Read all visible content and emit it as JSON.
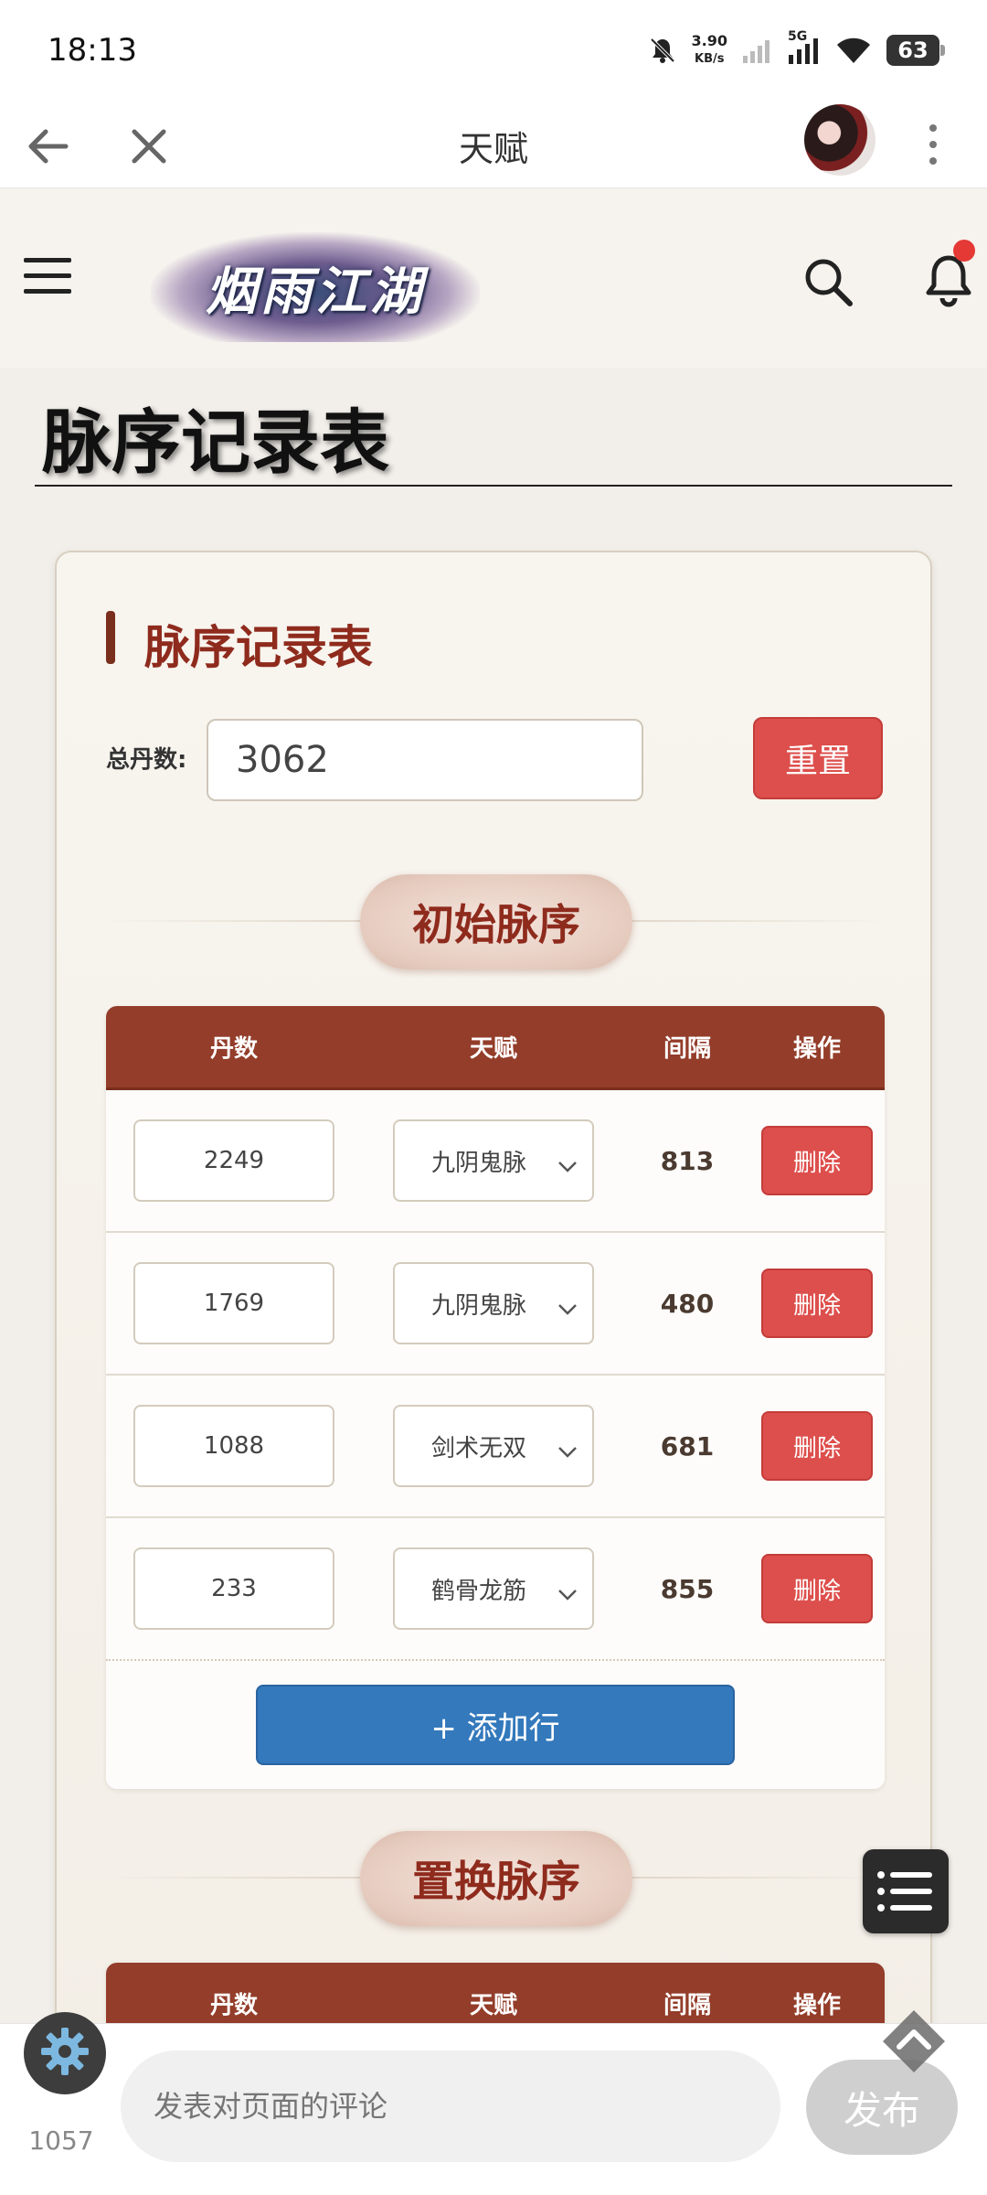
{
  "status_bar": {
    "time": "18:13",
    "net_speed_value": "3.90",
    "net_speed_unit": "KB/s",
    "network_type": "5G",
    "battery": "63"
  },
  "nav": {
    "title": "天赋"
  },
  "site_header": {
    "logo_text": "烟雨江湖"
  },
  "page": {
    "title": "脉序记录表"
  },
  "card": {
    "heading": "脉序记录表",
    "total_label": "总丹数:",
    "total_value": "3062",
    "reset_label": "重置"
  },
  "initial_section": {
    "badge": "初始脉序",
    "headers": [
      "丹数",
      "天赋",
      "间隔",
      "操作"
    ],
    "rows": [
      {
        "dan": "2249",
        "talent": "九阴鬼脉",
        "gap": "813",
        "action": "删除"
      },
      {
        "dan": "1769",
        "talent": "九阴鬼脉",
        "gap": "480",
        "action": "删除"
      },
      {
        "dan": "1088",
        "talent": "剑术无双",
        "gap": "681",
        "action": "删除"
      },
      {
        "dan": "233",
        "talent": "鹤骨龙筋",
        "gap": "855",
        "action": "删除"
      }
    ],
    "add_row_label": "+ 添加行"
  },
  "replace_section": {
    "badge": "置换脉序",
    "headers": [
      "丹数",
      "天赋",
      "间隔",
      "操作"
    ]
  },
  "bottom_bar": {
    "comment_count": "1057",
    "comment_placeholder": "发表对页面的评论",
    "publish_label": "发布"
  },
  "colors": {
    "table_header": "#933d2a",
    "delete_button": "#dd4f4c",
    "add_button": "#3379bc",
    "heading_red": "#8e2b1d"
  },
  "icons": [
    "back-arrow-icon",
    "close-icon",
    "more-vertical-icon",
    "hamburger-menu-icon",
    "search-icon",
    "bell-icon",
    "chevron-down-icon",
    "list-icon",
    "chevron-up-icon",
    "gear-icon",
    "comment-icon"
  ]
}
